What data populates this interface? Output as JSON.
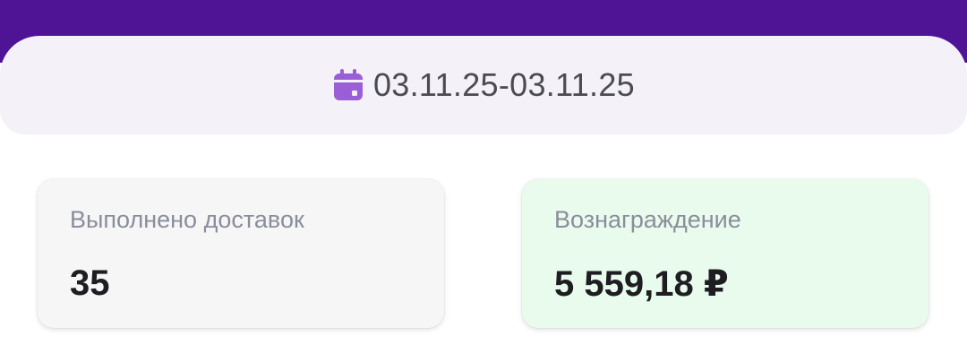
{
  "header": {
    "background_color": "#4f1496"
  },
  "date_filter": {
    "icon": "calendar-icon",
    "icon_color": "#9a5fd6",
    "range_text": "03.11.25-03.11.25"
  },
  "stats": {
    "deliveries": {
      "label": "Выполнено доставок",
      "value": "35"
    },
    "reward": {
      "label": "Вознаграждение",
      "value": "5 559,18 ₽",
      "background_color": "#e9fbec"
    }
  }
}
